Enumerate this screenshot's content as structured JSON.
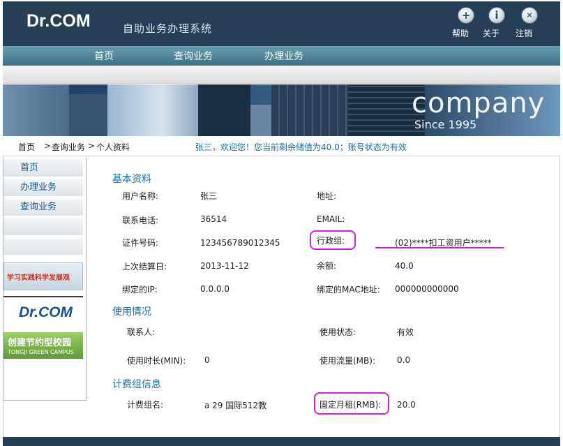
{
  "header": {
    "logo": "Dr.COM",
    "subtitle": "自助业务办理系统",
    "icons": [
      {
        "name": "help",
        "glyph": "+",
        "label": "帮助"
      },
      {
        "name": "about",
        "glyph": "i",
        "label": "关于"
      },
      {
        "name": "logout",
        "glyph": "✕",
        "label": "注销"
      }
    ]
  },
  "nav": {
    "items": [
      "首页",
      "查询业务",
      "办理业务"
    ]
  },
  "banner": {
    "big": "company",
    "small": "Since 1995"
  },
  "breadcrumb": {
    "home": "首页",
    "query": "查询业务",
    "current": "个人资料",
    "sep": ">",
    "welcome": "张三，欢迎您！您当前剩余储值为40.0；账号状态为有效"
  },
  "sidebar": {
    "items": [
      "首页",
      "办理业务",
      "查询业务"
    ],
    "study_banner": "学习实践科学发展观",
    "drcom_logo": "Dr.COM",
    "green_banner_title": "创建节约型校园",
    "green_banner_sub": "TONGJI GREEN CAMPUS"
  },
  "basic": {
    "title": "基本资料",
    "username_label": "用户名称:",
    "username": "张三",
    "address_label": "地址:",
    "address": "",
    "phone_label": "联系电话:",
    "phone": "36514",
    "email_label": "EMAIL:",
    "email": "",
    "id_label": "证件号码:",
    "id": "123456789012345",
    "group_label": "行政组:",
    "group": "(02)****扣工资用户*****",
    "settle_label": "上次结算日:",
    "settle": "2013-11-12",
    "balance_label": "余额:",
    "balance": "40.0",
    "ip_label": "绑定的IP:",
    "ip": "0.0.0.0",
    "mac_label": "绑定的MAC地址:",
    "mac": "000000000000"
  },
  "usage": {
    "title": "使用情况",
    "contact_label": "联系人:",
    "contact": "",
    "status_label": "使用状态:",
    "status": "有效",
    "duration_label": "使用时长(MIN):",
    "duration": "0",
    "traffic_label": "使用流量(MB):",
    "traffic": "0.0"
  },
  "billing": {
    "title": "计费组信息",
    "group_name_label": "计费组名:",
    "group_name": "a 29 国际512教",
    "rent_label": "固定月租(RMB):",
    "rent": "20.0"
  },
  "colors": {
    "header": "#263f56",
    "nav": "#3b6f82",
    "link": "#1a6ea0",
    "annotation": "#d61fd6"
  }
}
